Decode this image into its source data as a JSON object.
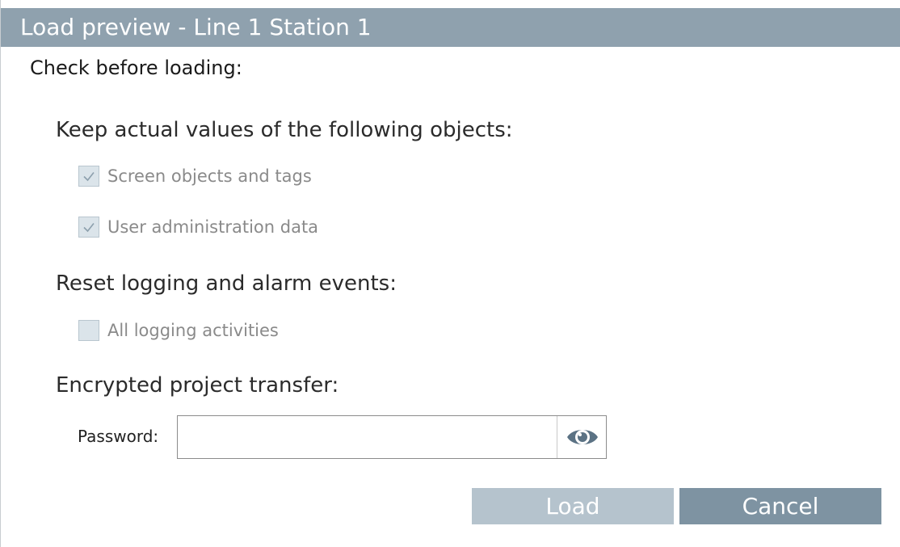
{
  "dialog": {
    "title": "Load preview - Line 1 Station 1",
    "heading": "Check before loading:"
  },
  "keep_values": {
    "label": "Keep actual values of the following objects:",
    "options": [
      {
        "label": "Screen objects and tags",
        "checked": true,
        "enabled": false
      },
      {
        "label": "User administration data",
        "checked": true,
        "enabled": false
      }
    ]
  },
  "reset_logging": {
    "label": "Reset logging and alarm events:",
    "options": [
      {
        "label": "All logging activities",
        "checked": false,
        "enabled": false
      }
    ]
  },
  "encrypted_transfer": {
    "label": "Encrypted project transfer:",
    "password_label": "Password:",
    "password_value": "",
    "show_password_icon": "eye-icon"
  },
  "buttons": {
    "load": {
      "label": "Load",
      "enabled": false
    },
    "cancel": {
      "label": "Cancel",
      "enabled": true
    }
  },
  "colors": {
    "titlebar": "#8fa1ae",
    "load_button": "#b5c3cd",
    "cancel_button": "#7e93a2",
    "checkbox_fill": "#dbe4ea",
    "eye_icon": "#5b7284"
  }
}
